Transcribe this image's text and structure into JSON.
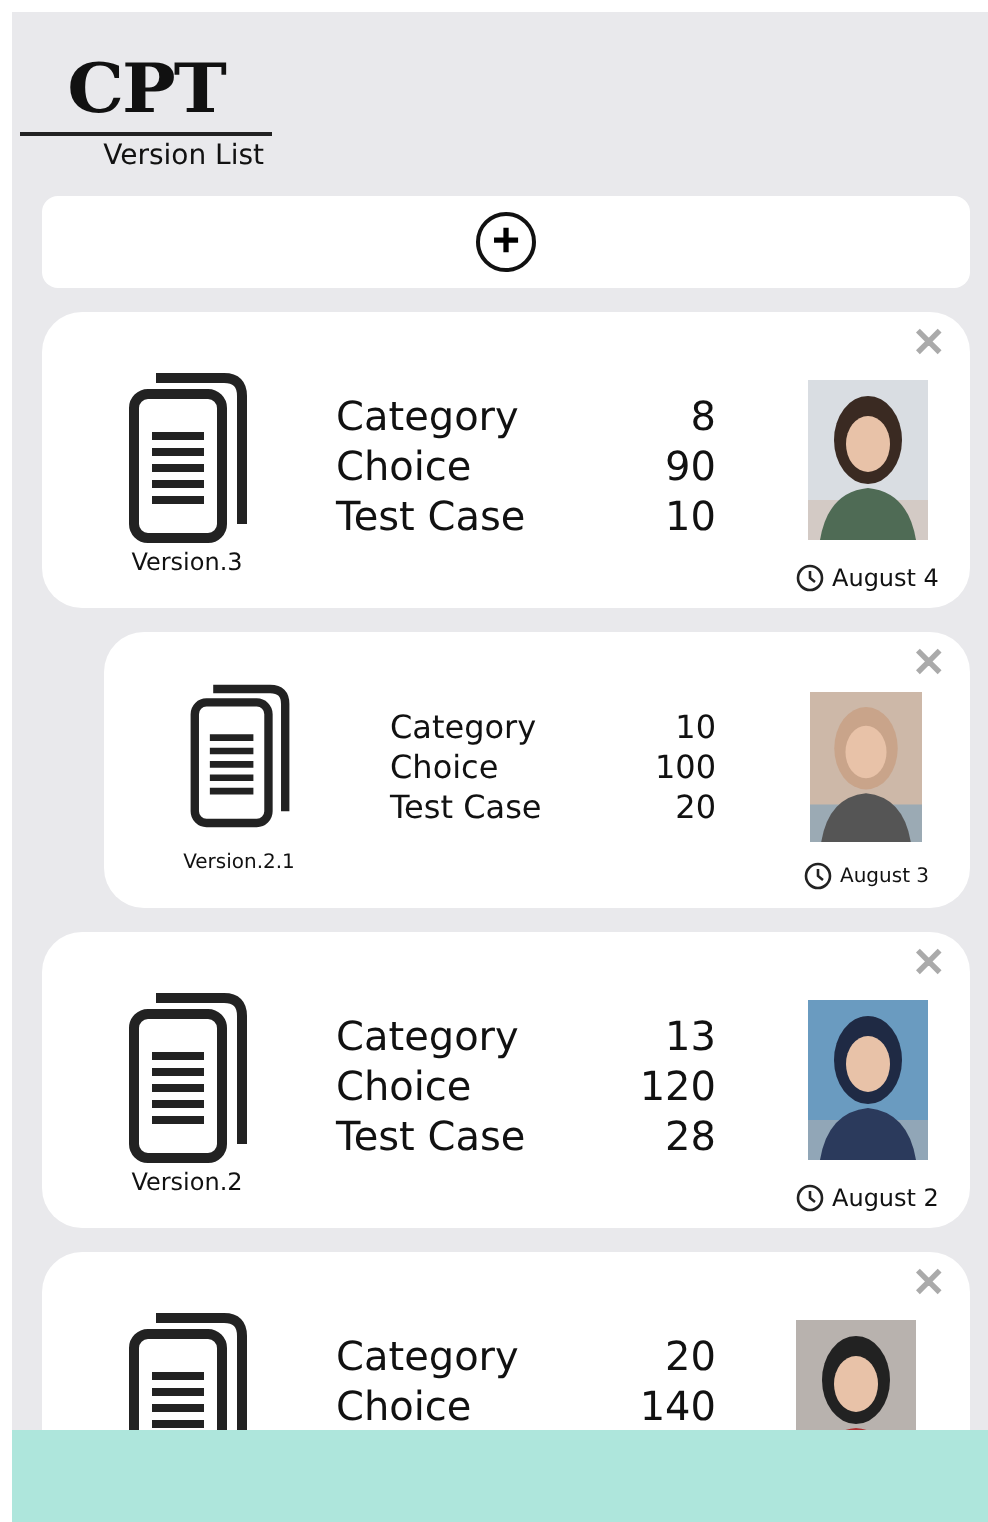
{
  "header": {
    "logo": "CPT",
    "subtitle": "Version List"
  },
  "add_button": {
    "label": "+"
  },
  "versions": [
    {
      "kind": "main",
      "version": "Version.3",
      "stats": [
        {
          "label": "Category",
          "value": "8"
        },
        {
          "label": "Choice",
          "value": "90"
        },
        {
          "label": "Test Case",
          "value": "10"
        }
      ],
      "date": "August 4",
      "close": "✕"
    },
    {
      "kind": "sub",
      "version": "Version.2.1",
      "stats": [
        {
          "label": "Category",
          "value": "10"
        },
        {
          "label": "Choice",
          "value": "100"
        },
        {
          "label": "Test Case",
          "value": "20"
        }
      ],
      "date": "August 3",
      "close": "✕"
    },
    {
      "kind": "main",
      "version": "Version.2",
      "stats": [
        {
          "label": "Category",
          "value": "13"
        },
        {
          "label": "Choice",
          "value": "120"
        },
        {
          "label": "Test Case",
          "value": "28"
        }
      ],
      "date": "August 2",
      "close": "✕"
    },
    {
      "kind": "main",
      "stats": [
        {
          "label": "Category",
          "value": "20"
        },
        {
          "label": "Choice",
          "value": "140"
        }
      ],
      "close": "✕"
    }
  ]
}
